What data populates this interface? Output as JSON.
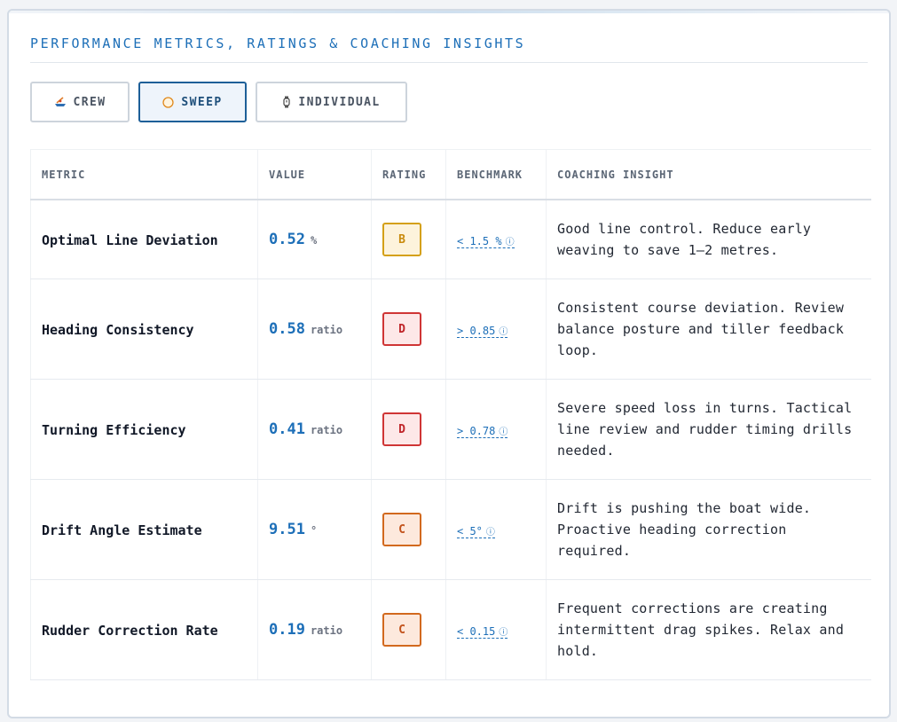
{
  "header": {
    "title": "PERFORMANCE METRICS, RATINGS & COACHING INSIGHTS"
  },
  "tabs": [
    {
      "label": "CREW",
      "icon": "rowing-boat-icon",
      "active": false
    },
    {
      "label": "SWEEP",
      "icon": "compass-icon",
      "active": true
    },
    {
      "label": "INDIVIDUAL",
      "icon": "stopwatch-icon",
      "active": false
    }
  ],
  "table": {
    "headers": [
      "METRIC",
      "VALUE",
      "RATING",
      "BENCHMARK",
      "COACHING INSIGHT"
    ],
    "rows": [
      {
        "metric": "Optimal Line Deviation",
        "value": "0.52",
        "unit": "%",
        "rating": "B",
        "benchmark": "< 1.5 %",
        "insight": "Good line control. Reduce early weaving to save 1–2 metres."
      },
      {
        "metric": "Heading Consistency",
        "value": "0.58",
        "unit": "ratio",
        "rating": "D",
        "benchmark": "> 0.85",
        "insight": "Consistent course deviation. Review balance posture and tiller feedback loop."
      },
      {
        "metric": "Turning Efficiency",
        "value": "0.41",
        "unit": "ratio",
        "rating": "D",
        "benchmark": "> 0.78",
        "insight": "Severe speed loss in turns. Tactical line review and rudder timing drills needed."
      },
      {
        "metric": "Drift Angle Estimate",
        "value": "9.51",
        "unit": "°",
        "rating": "C",
        "benchmark": "< 5°",
        "insight": "Drift is pushing the boat wide. Proactive heading correction required."
      },
      {
        "metric": "Rudder Correction Rate",
        "value": "0.19",
        "unit": "ratio",
        "rating": "C",
        "benchmark": "< 0.15",
        "insight": "Frequent corrections are creating intermittent drag spikes. Relax and hold."
      }
    ]
  },
  "info_icon": "ⓘ",
  "colors": {
    "accent": "#1d6fb8",
    "rating_B": {
      "text": "#c98a0c",
      "border": "#d4a017",
      "bg": "#fdf3dc"
    },
    "rating_C": {
      "text": "#c2521b",
      "border": "#d2691e",
      "bg": "#fde9dd"
    },
    "rating_D": {
      "text": "#c0262a",
      "border": "#cf3535",
      "bg": "#fde8e8"
    }
  }
}
